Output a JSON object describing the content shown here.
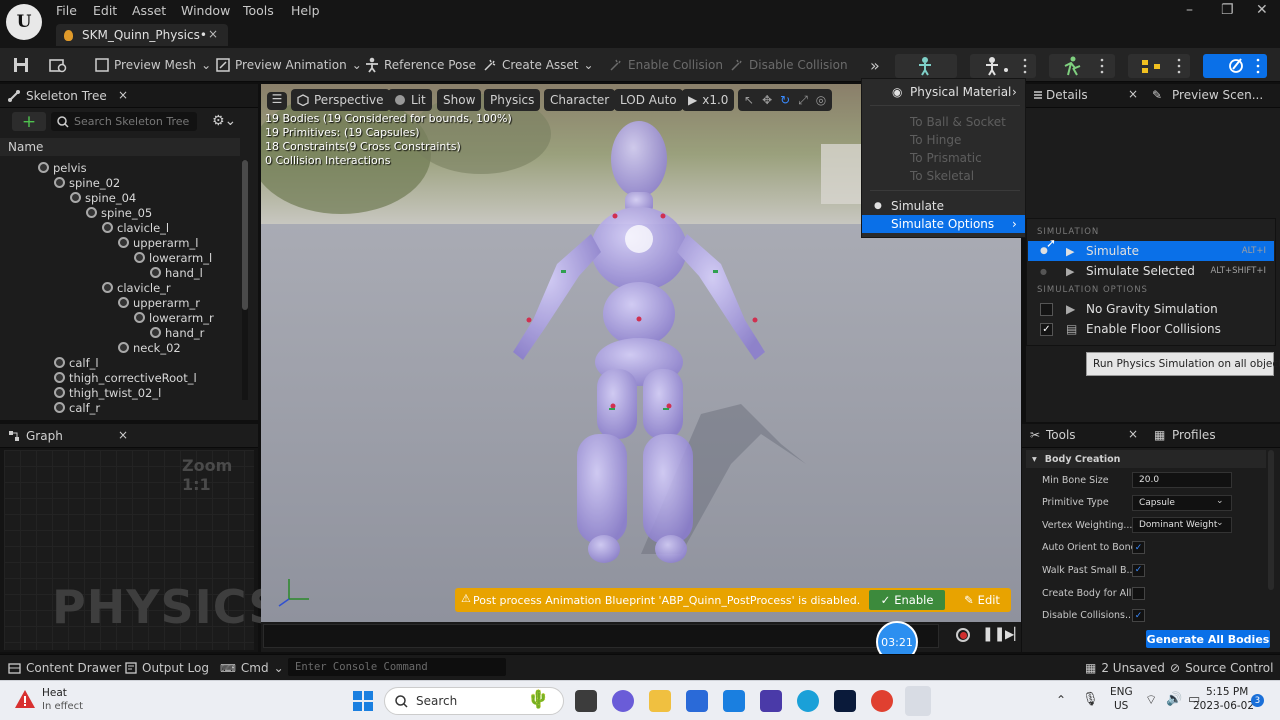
{
  "app": {
    "logo": "U"
  },
  "menubar": {
    "items": [
      "File",
      "Edit",
      "Asset",
      "Window",
      "Tools",
      "Help"
    ]
  },
  "tab": {
    "title": "SKM_Quinn_Physics•",
    "close": "×"
  },
  "toolbar": {
    "preview_mesh": "Preview Mesh",
    "preview_animation": "Preview Animation",
    "reference_pose": "Reference Pose",
    "create_asset": "Create Asset",
    "enable_collision": "Enable Collision",
    "disable_collision": "Disable Collision"
  },
  "skeleton_tree": {
    "title": "Skeleton Tree",
    "search_placeholder": "Search Skeleton Tree",
    "column_name": "Name",
    "bones": [
      {
        "label": "pelvis",
        "depth": 0
      },
      {
        "label": "spine_02",
        "depth": 1
      },
      {
        "label": "spine_04",
        "depth": 2
      },
      {
        "label": "spine_05",
        "depth": 3
      },
      {
        "label": "clavicle_l",
        "depth": 4
      },
      {
        "label": "upperarm_l",
        "depth": 5
      },
      {
        "label": "lowerarm_l",
        "depth": 6
      },
      {
        "label": "hand_l",
        "depth": 7
      },
      {
        "label": "clavicle_r",
        "depth": 4
      },
      {
        "label": "upperarm_r",
        "depth": 5
      },
      {
        "label": "lowerarm_r",
        "depth": 6
      },
      {
        "label": "hand_r",
        "depth": 7
      },
      {
        "label": "neck_02",
        "depth": 5
      },
      {
        "label": "calf_l",
        "depth": 1
      },
      {
        "label": "thigh_correctiveRoot_l",
        "depth": 1
      },
      {
        "label": "thigh_twist_02_l",
        "depth": 1
      },
      {
        "label": "calf_r",
        "depth": 1
      }
    ]
  },
  "graph": {
    "title": "Graph",
    "zoom": "Zoom 1:1",
    "watermark": "PHYSICS"
  },
  "viewport": {
    "perspective": "Perspective",
    "lit": "Lit",
    "show": "Show",
    "physics": "Physics",
    "character": "Character",
    "lod": "LOD Auto",
    "speed": "x1.0",
    "stats": [
      "19 Bodies (19 Considered for bounds, 100%)",
      "19 Primitives: (19 Capsules)",
      "18 Constraints(9 Cross Constraints)",
      "0 Collision Interactions"
    ],
    "warning": "Post process Animation Blueprint 'ABP_Quinn_PostProcess' is disabled.",
    "enable_label": "Enable",
    "edit_label": "Edit",
    "timer": "03:21"
  },
  "dropdown": {
    "physical_material": "Physical Material",
    "to_ball_socket": "To Ball & Socket",
    "to_hinge": "To Hinge",
    "to_prismatic": "To Prismatic",
    "to_skeletal": "To Skeletal",
    "simulate": "Simulate",
    "simulate_options": "Simulate Options"
  },
  "details_tabs": {
    "details": "Details",
    "preview_scene": "Preview Scen..."
  },
  "submenu": {
    "section_simulation": "SIMULATION",
    "simulate": "Simulate",
    "simulate_shortcut": "ALT+I",
    "simulate_selected": "Simulate Selected",
    "simulate_selected_shortcut": "ALT+SHIFT+I",
    "section_options": "SIMULATION OPTIONS",
    "no_gravity": "No Gravity Simulation",
    "no_gravity_checked": false,
    "floor_collisions": "Enable Floor Collisions",
    "floor_collisions_checked": true
  },
  "tooltip": "Run Physics Simulation on all objects.",
  "tools": {
    "tab_tools": "Tools",
    "tab_profiles": "Profiles",
    "section": "Body Creation",
    "rows": [
      {
        "label": "Min Bone Size",
        "value": "20.0",
        "kind": "text"
      },
      {
        "label": "Primitive Type",
        "value": "Capsule",
        "kind": "combo"
      },
      {
        "label": "Vertex Weighting...",
        "value": "Dominant Weight",
        "kind": "combo"
      },
      {
        "label": "Auto Orient to Bone",
        "value": "✓",
        "kind": "check"
      },
      {
        "label": "Walk Past Small B...",
        "value": "✓",
        "kind": "check"
      },
      {
        "label": "Create Body for All...",
        "value": "",
        "kind": "check"
      },
      {
        "label": "Disable Collisions...",
        "value": "✓",
        "kind": "check"
      }
    ],
    "generate": "Generate All Bodies"
  },
  "statusbar": {
    "content_drawer": "Content Drawer",
    "output_log": "Output Log",
    "cmd": "Cmd",
    "console_placeholder": "Enter Console Command",
    "unsaved": "2 Unsaved",
    "source_control": "Source Control"
  },
  "taskbar": {
    "heat_title": "Heat",
    "heat_sub": "In effect",
    "search": "Search",
    "lang1": "ENG",
    "lang2": "US",
    "time": "5:15 PM",
    "date": "2023-06-02",
    "notif": "3"
  },
  "colors": {
    "accent": "#0a70e8",
    "warning": "#e8a300",
    "enable_green": "#3c8a3c"
  }
}
